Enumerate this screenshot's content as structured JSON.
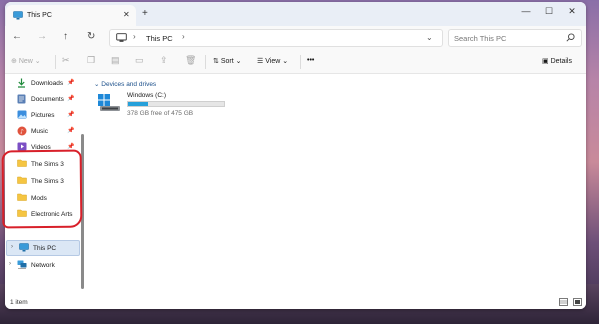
{
  "tab": {
    "title": "This PC"
  },
  "window_controls": {
    "minimize": "—",
    "maximize": "☐",
    "close": "✕"
  },
  "address": {
    "path_label": "This PC"
  },
  "search": {
    "placeholder": "Search This PC"
  },
  "toolbar": {
    "new_label": "New",
    "sort_label": "Sort",
    "view_label": "View",
    "more_label": "•••",
    "details_label": "Details"
  },
  "sidebar": {
    "quick_access": [
      {
        "label": "Downloads",
        "icon": "download-icon",
        "pinned": true
      },
      {
        "label": "Documents",
        "icon": "document-icon",
        "pinned": true
      },
      {
        "label": "Pictures",
        "icon": "picture-icon",
        "pinned": true
      },
      {
        "label": "Music",
        "icon": "music-icon",
        "pinned": true
      },
      {
        "label": "Videos",
        "icon": "video-icon",
        "pinned": true
      }
    ],
    "folders": [
      {
        "label": "The Sims 3"
      },
      {
        "label": "The Sims 3"
      },
      {
        "label": "Mods"
      },
      {
        "label": "Electronic Arts"
      }
    ],
    "this_pc_label": "This PC",
    "network_label": "Network"
  },
  "content": {
    "group_label": "Devices and drives",
    "drives": [
      {
        "name": "Windows (C:)",
        "free_text": "378 GB free of 475 GB",
        "used_fraction": 0.204
      }
    ]
  },
  "status": {
    "item_count": "1 item"
  },
  "colors": {
    "accent": "#26a0da",
    "annotation": "#d8202a",
    "group_header": "#1b4f8a",
    "folder": "#f5c542"
  }
}
